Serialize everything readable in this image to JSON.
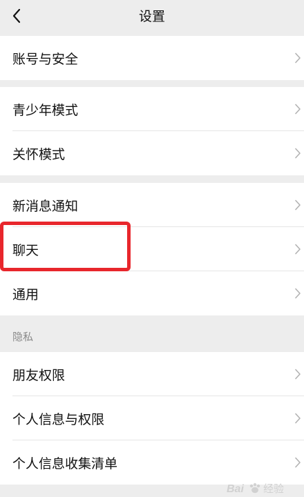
{
  "header": {
    "title": "设置",
    "back_icon": "chevron-left-icon"
  },
  "groups": [
    {
      "items": [
        {
          "label": "账号与安全"
        }
      ]
    },
    {
      "items": [
        {
          "label": "青少年模式"
        },
        {
          "label": "关怀模式"
        }
      ]
    },
    {
      "items": [
        {
          "label": "新消息通知"
        },
        {
          "label": "聊天"
        },
        {
          "label": "通用"
        }
      ]
    },
    {
      "header": "隐私",
      "items": [
        {
          "label": "朋友权限"
        },
        {
          "label": "个人信息与权限"
        },
        {
          "label": "个人信息收集清单"
        }
      ]
    }
  ],
  "annotation": {
    "highlight_color": "#e8262c",
    "highlighted_item": "聊天"
  },
  "watermark": {
    "text": "Bai 经验"
  },
  "colors": {
    "background": "#ededed",
    "cell": "#ffffff",
    "divider": "#e5e5e5",
    "chevron": "#b2b2b2",
    "section_text": "#8a8a8a"
  }
}
